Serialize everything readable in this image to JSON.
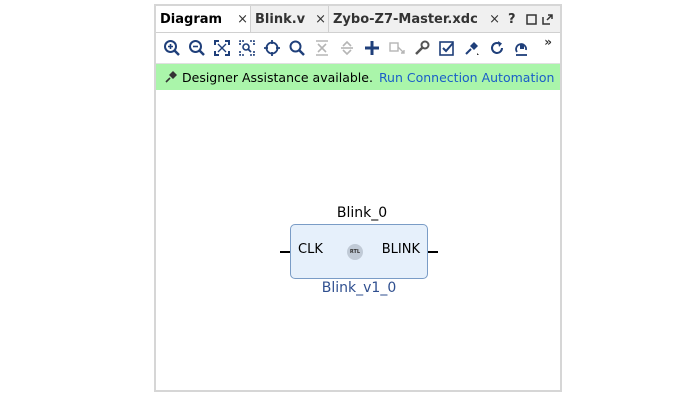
{
  "tabs": [
    {
      "label": "Diagram",
      "active": true
    },
    {
      "label": "Blink.v",
      "active": false
    },
    {
      "label": "Zybo-Z7-Master.xdc",
      "active": false
    }
  ],
  "tab_controls": {
    "help": "?",
    "close_icon": "×"
  },
  "toolbar": {
    "icons": [
      "zoom-in-icon",
      "zoom-out-icon",
      "fit-full-icon",
      "fit-selection-icon",
      "crosshair-icon",
      "search-icon",
      "collapse-icon",
      "expand-icon",
      "add-ip-icon",
      "make-external-icon",
      "wrench-icon",
      "validate-icon",
      "pin-icon",
      "refresh-icon",
      "regenerate-layout-icon"
    ],
    "more": "»"
  },
  "banner": {
    "text": "Designer Assistance available.",
    "link": "Run Connection Automation",
    "color": "#aaf5aa"
  },
  "block": {
    "instance_name": "Blink_0",
    "input_port": "CLK",
    "output_port": "BLINK",
    "badge": "RTL",
    "ip_name": "Blink_v1_0",
    "fill": "#e6f0fb",
    "border": "#7a9cc6"
  }
}
